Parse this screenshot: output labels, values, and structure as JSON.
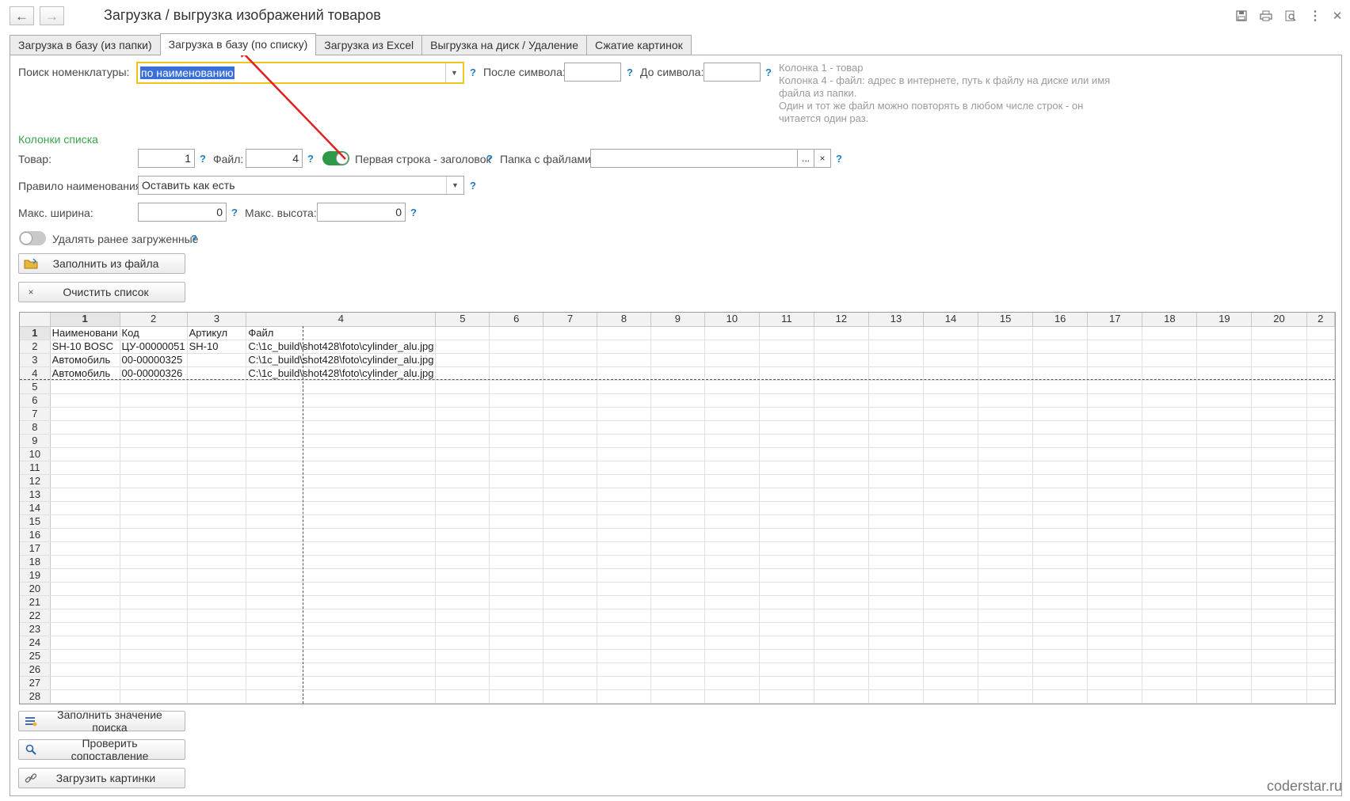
{
  "window": {
    "title": "Загрузка / выгрузка изображений товаров",
    "watermark": "coderstar.ru"
  },
  "tabs": [
    {
      "label": "Загрузка в базу (из папки)",
      "active": false
    },
    {
      "label": "Загрузка в базу (по списку)",
      "active": true
    },
    {
      "label": "Загрузка из Excel",
      "active": false
    },
    {
      "label": "Выгрузка на диск / Удаление",
      "active": false
    },
    {
      "label": "Сжатие картинок",
      "active": false
    }
  ],
  "search": {
    "label": "Поиск номенклатуры:",
    "value": "по наименованию",
    "after_label": "После символа:",
    "after_value": "",
    "before_label": "До символа:",
    "before_value": "",
    "help": "?"
  },
  "hint_lines": [
    "Колонка 1 - товар",
    "Колонка 4 - файл: адрес в интернете, путь к файлу на диске или имя файла из папки.",
    "Один и тот же файл можно повторять в любом числе строк - он читается один раз."
  ],
  "columns": {
    "section_label": "Колонки списка",
    "product_label": "Товар:",
    "product_value": "1",
    "file_label": "Файл:",
    "file_value": "4",
    "first_row_header_label": "Первая строка - заголовок",
    "first_row_header_on": true,
    "folder_label": "Папка с файлами:",
    "folder_value": "",
    "folder_btn": "...",
    "folder_clear": "×"
  },
  "naming": {
    "label": "Правило наименования:",
    "value": "Оставить как есть"
  },
  "size": {
    "max_width_label": "Макс. ширина:",
    "max_width_value": "0",
    "max_height_label": "Макс. высота:",
    "max_height_value": "0"
  },
  "delete_prev": {
    "label": "Удалять ранее загруженные",
    "on": false
  },
  "buttons": {
    "fill_from_file": "Заполнить из файла",
    "clear_list": "Очистить список",
    "fill_search": "Заполнить значение поиска",
    "check_match": "Проверить сопоставление",
    "load_images": "Загрузить картинки"
  },
  "spreadsheet": {
    "col_headers": [
      "1",
      "2",
      "3",
      "4",
      "5",
      "6",
      "7",
      "8",
      "9",
      "10",
      "11",
      "12",
      "13",
      "14",
      "15",
      "16",
      "17",
      "18",
      "19",
      "20",
      "2"
    ],
    "rows": [
      {
        "n": "1",
        "cells": [
          "Наименовани",
          "Код",
          "Артикул",
          "Файл"
        ]
      },
      {
        "n": "2",
        "cells": [
          "SH-10 BOSC",
          "ЦУ-00000051",
          "SH-10",
          "C:\\1c_build\\shot428\\foto\\cylinder_alu.jpg"
        ]
      },
      {
        "n": "3",
        "cells": [
          "Автомобиль",
          "00-00000325",
          "",
          "C:\\1c_build\\shot428\\foto\\cylinder_alu.jpg"
        ]
      },
      {
        "n": "4",
        "cells": [
          "Автомобиль",
          "00-00000326",
          "",
          "C:\\1c_build\\shot428\\foto\\cylinder_alu.jpg"
        ]
      },
      {
        "n": "5",
        "cells": []
      },
      {
        "n": "6",
        "cells": []
      },
      {
        "n": "7",
        "cells": []
      },
      {
        "n": "8",
        "cells": []
      },
      {
        "n": "9",
        "cells": []
      },
      {
        "n": "10",
        "cells": []
      },
      {
        "n": "11",
        "cells": []
      },
      {
        "n": "12",
        "cells": []
      },
      {
        "n": "13",
        "cells": []
      },
      {
        "n": "14",
        "cells": []
      },
      {
        "n": "15",
        "cells": []
      },
      {
        "n": "16",
        "cells": []
      },
      {
        "n": "17",
        "cells": []
      },
      {
        "n": "18",
        "cells": []
      },
      {
        "n": "19",
        "cells": []
      },
      {
        "n": "20",
        "cells": []
      },
      {
        "n": "21",
        "cells": []
      },
      {
        "n": "22",
        "cells": []
      },
      {
        "n": "23",
        "cells": []
      },
      {
        "n": "24",
        "cells": []
      },
      {
        "n": "25",
        "cells": []
      },
      {
        "n": "26",
        "cells": []
      },
      {
        "n": "27",
        "cells": []
      },
      {
        "n": "28",
        "cells": []
      }
    ]
  },
  "colors": {
    "accent_input_border": "#f0c419",
    "selection_bg": "#3a6fd8",
    "toggle_on": "#2e9a47",
    "help": "#1c7ec2",
    "arrow": "#e02020"
  }
}
